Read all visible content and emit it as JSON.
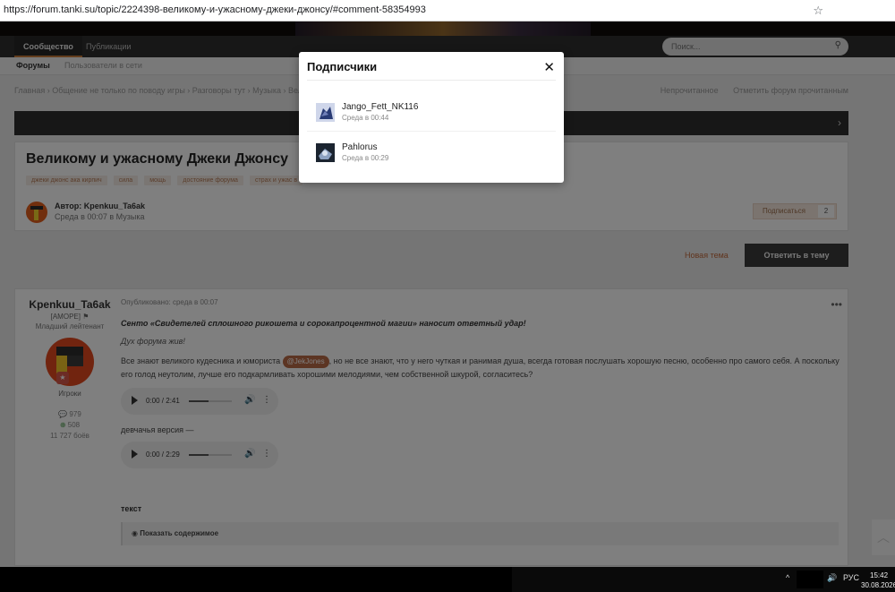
{
  "browser": {
    "url": "https://forum.tanki.su/topic/2224398-великому-и-ужасному-джеки-джонсу/#comment-58354993"
  },
  "nav": {
    "tabs": [
      "Сообщество",
      "Публикации"
    ],
    "subtabs": [
      "Форумы",
      "Пользователи в сети"
    ],
    "search_placeholder": "Поиск..."
  },
  "breadcrumbs": "Главная  ›  Общение не только по поводу игры  ›  Разговоры тут  ›  Музыка  ›  Вел",
  "crumb_actions": [
    "Непрочитанное",
    "Отметить форум прочитанным"
  ],
  "topic": {
    "title": "Великому и ужасному Джеки Джонсу",
    "tags": [
      "джеки джонс ака кирпич",
      "сила",
      "мощь",
      "достояние форума",
      "страх и ужас в"
    ],
    "author_line": "Автор: Kpenkuu_Ta6ak",
    "when_line": "Среда в 00:07 в Музыка",
    "subscribe_label": "Подписаться",
    "subscribe_count": "2"
  },
  "actions": {
    "new_topic": "Новая тема",
    "reply": "Ответить в тему"
  },
  "post": {
    "author": "Kpenkuu_Ta6ak",
    "clan": "[AMOPE]",
    "rank": "Младший лейтенант",
    "group": "Игроки",
    "stats": [
      "979",
      "508",
      "11 727 боёв"
    ],
    "published": "Опубликовано: среда в 00:07",
    "line1": "Сенто «Свидетелей сплошного рикошета и сорокапроцентной магии» наносит ответный удар!",
    "line2": "Дух форума жив!",
    "line3_a": "Все знают великого кудесника и юмориста",
    "mention": "@JekJones",
    "line3_b": ", но не все знают, что у него чуткая и ранимая душа, всегда готовая послушать хорошую песню, особенно про самого себя. А поскольку его голод неутолим, лучше его подкармливать хорошими мелодиями, чем собственной шкурой, согласитесь?",
    "audio1_time": "0:00 / 2:41",
    "audio1_progress": 0.45,
    "girl_version": "девчачья версия —",
    "audio2_time": "0:00 / 2:29",
    "audio2_progress": 0.45,
    "text_label": "текст",
    "spoiler": "Показать содержимое"
  },
  "modal": {
    "title": "Подписчики",
    "followers": [
      {
        "name": "Jango_Fett_NK116",
        "time": "Среда в 00:44"
      },
      {
        "name": "Pahlorus",
        "time": "Среда в 00:29"
      }
    ]
  },
  "taskbar": {
    "lang": "РУС",
    "time": "15:42",
    "date": "30.08.2026"
  },
  "colors": {
    "accent": "#c77a3b",
    "mention": "#b96a46",
    "dark": "#2f2f2f"
  }
}
